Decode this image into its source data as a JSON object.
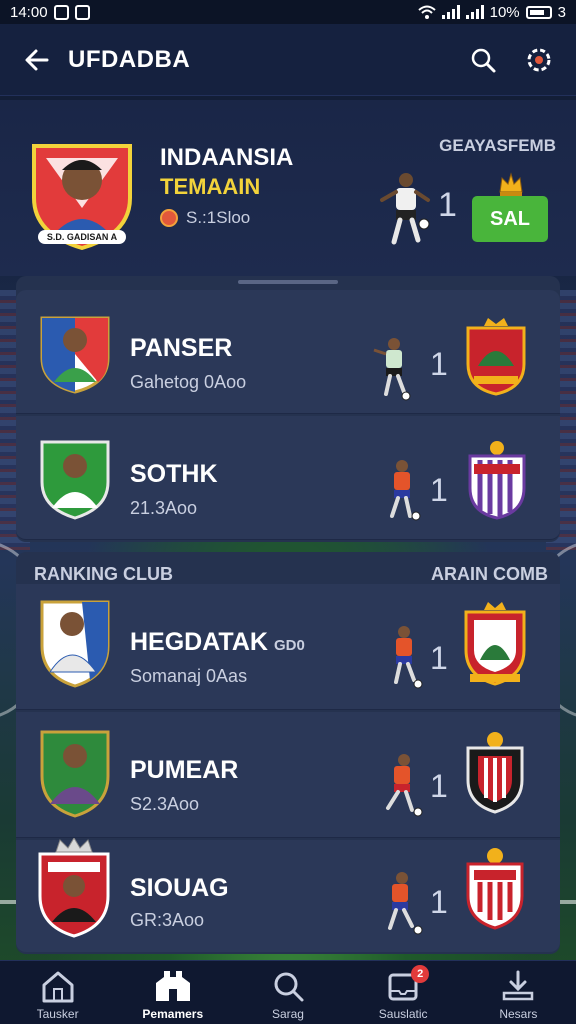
{
  "status_bar": {
    "time": "14:00",
    "battery": "10%",
    "battery_level": 3
  },
  "app_bar": {
    "title": "UFDADBA"
  },
  "hero": {
    "shield_caption": "S.D. GADISAN A",
    "name": "INDAANSIA",
    "subtitle": "TEMAAIN",
    "meta": "S.:1Sloo",
    "right_label": "GEAYASFEMB",
    "rank": "1",
    "action_label": "SAL"
  },
  "players_top": [
    {
      "name": "PANSER",
      "meta": "Gahetog 0Aoo",
      "rank": "1"
    },
    {
      "name": "SOTHK",
      "meta": "21.3Aoo",
      "rank": "1"
    }
  ],
  "ranking": {
    "title": "RANKING CLUB",
    "right_label": "ARAIN COMB",
    "items": [
      {
        "name": "HEGDATAK",
        "extra": "GD0",
        "meta": "Somanaj 0Aas",
        "rank": "1"
      },
      {
        "name": "PUMEAR",
        "meta": "S2.3Aoo",
        "rank": "1"
      },
      {
        "name": "SIOUAG",
        "meta": "GR:3Aoo",
        "rank": "1"
      }
    ]
  },
  "bottom_nav": [
    {
      "label": "Tausker",
      "icon": "home-icon"
    },
    {
      "label": "Pemamers",
      "icon": "stadium-icon"
    },
    {
      "label": "Sarag",
      "icon": "search-icon"
    },
    {
      "label": "Sauslatic",
      "icon": "inbox-icon",
      "badge": "2"
    },
    {
      "label": "Nesars",
      "icon": "download-icon"
    }
  ],
  "colors": {
    "accent_green": "#49b53b",
    "gold": "#f2d33b",
    "panel": "#25324f",
    "badge": "#e23b3b"
  }
}
